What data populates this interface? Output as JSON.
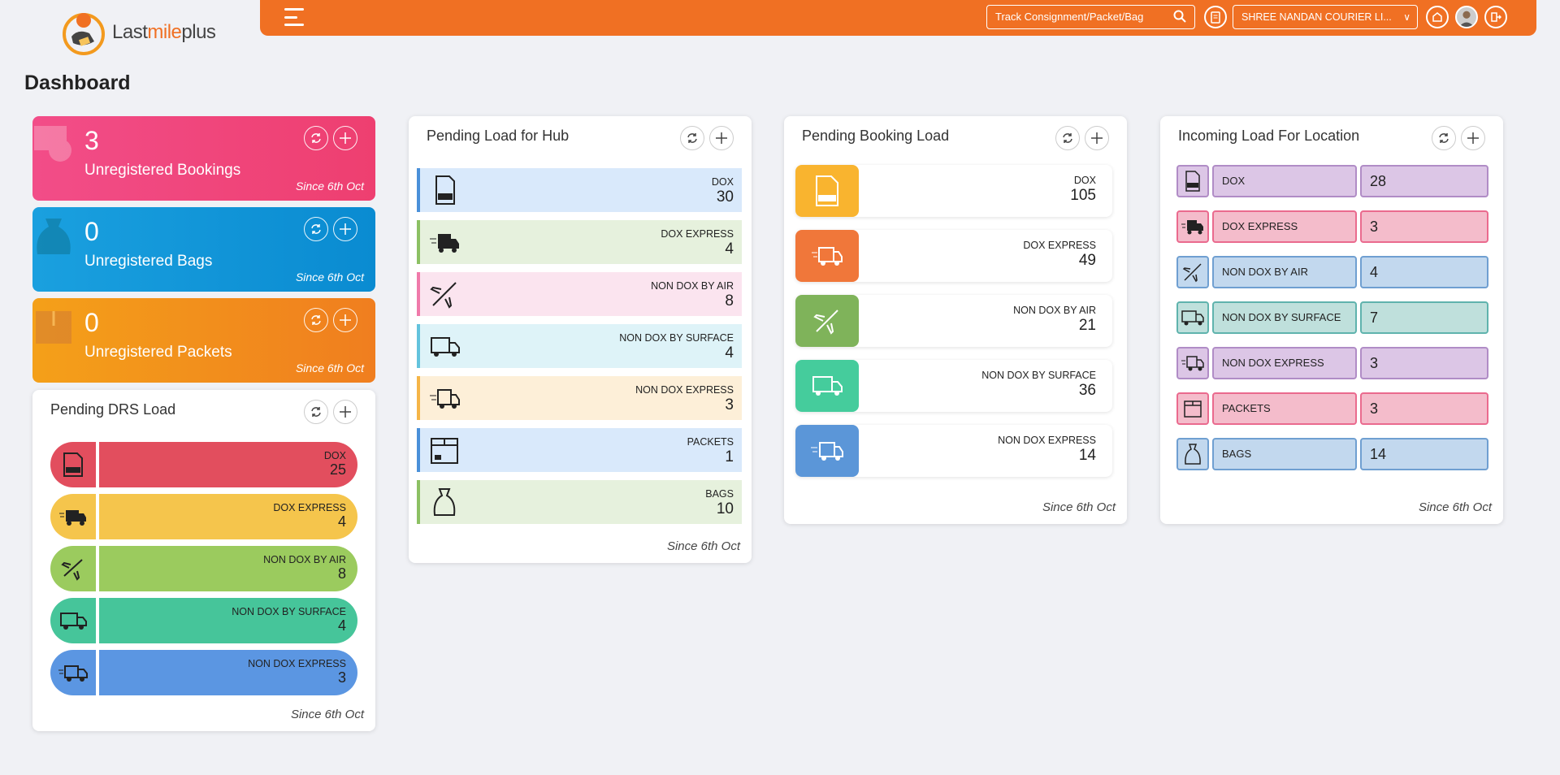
{
  "brand": {
    "logo_last": "Last",
    "logo_mile": "mile",
    "logo_plus": "plus"
  },
  "header": {
    "track_placeholder": "Track Consignment/Packet/Bag",
    "company": "SHREE NANDAN COURIER LI..."
  },
  "page_title": "Dashboard",
  "stats": [
    {
      "value": "3",
      "label": "Unregistered Bookings",
      "since": "Since 6th Oct"
    },
    {
      "value": "0",
      "label": "Unregistered Bags",
      "since": "Since 6th Oct"
    },
    {
      "value": "0",
      "label": "Unregistered Packets",
      "since": "Since 6th Oct"
    }
  ],
  "drs": {
    "title": "Pending DRS Load",
    "since": "Since 6th Oct",
    "rows": [
      {
        "label": "DOX",
        "value": "25"
      },
      {
        "label": "DOX EXPRESS",
        "value": "4"
      },
      {
        "label": "NON DOX BY AIR",
        "value": "8"
      },
      {
        "label": "NON DOX BY SURFACE",
        "value": "4"
      },
      {
        "label": "NON DOX EXPRESS",
        "value": "3"
      }
    ]
  },
  "hub": {
    "title": "Pending Load for Hub",
    "since": "Since 6th Oct",
    "rows": [
      {
        "label": "DOX",
        "value": "30"
      },
      {
        "label": "DOX EXPRESS",
        "value": "4"
      },
      {
        "label": "NON DOX BY AIR",
        "value": "8"
      },
      {
        "label": "NON DOX BY SURFACE",
        "value": "4"
      },
      {
        "label": "NON DOX EXPRESS",
        "value": "3"
      },
      {
        "label": "PACKETS",
        "value": "1"
      },
      {
        "label": "BAGS",
        "value": "10"
      }
    ]
  },
  "booking": {
    "title": "Pending Booking Load",
    "since": "Since 6th Oct",
    "rows": [
      {
        "label": "DOX",
        "value": "105"
      },
      {
        "label": "DOX EXPRESS",
        "value": "49"
      },
      {
        "label": "NON DOX BY AIR",
        "value": "21"
      },
      {
        "label": "NON DOX BY SURFACE",
        "value": "36"
      },
      {
        "label": "NON DOX EXPRESS",
        "value": "14"
      }
    ]
  },
  "incoming": {
    "title": "Incoming Load For Location",
    "since": "Since 6th Oct",
    "rows": [
      {
        "label": "DOX",
        "value": "28"
      },
      {
        "label": "DOX EXPRESS",
        "value": "3"
      },
      {
        "label": "NON DOX BY AIR",
        "value": "4"
      },
      {
        "label": "NON DOX BY SURFACE",
        "value": "7"
      },
      {
        "label": "NON DOX EXPRESS",
        "value": "3"
      },
      {
        "label": "PACKETS",
        "value": "3"
      },
      {
        "label": "BAGS",
        "value": "14"
      }
    ]
  },
  "icons": [
    "document-icon",
    "express-truck-icon",
    "plane-icon",
    "truck-icon",
    "speed-truck-icon",
    "box-icon",
    "bag-icon",
    "refresh-icon",
    "move-icon"
  ],
  "colors": {
    "accent": "#f07023",
    "pink_card": "#ee3f70",
    "blue_card": "#0a8bd1",
    "orange_card": "#f07e1f"
  }
}
